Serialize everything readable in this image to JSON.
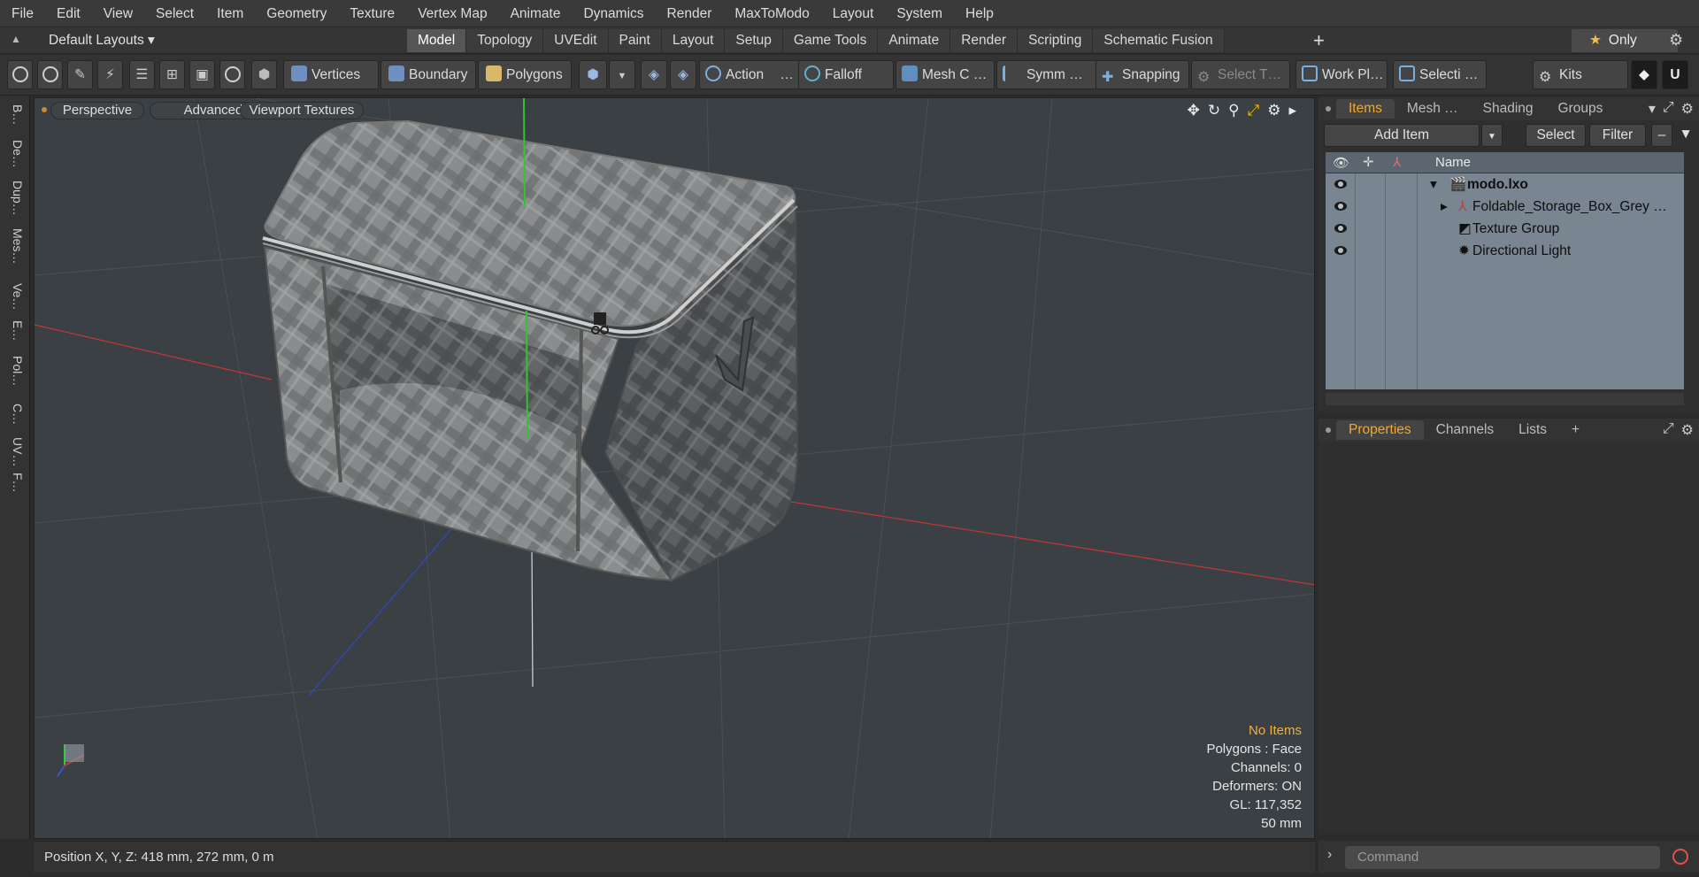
{
  "menu": [
    "File",
    "Edit",
    "View",
    "Select",
    "Item",
    "Geometry",
    "Texture",
    "Vertex Map",
    "Animate",
    "Dynamics",
    "Render",
    "MaxToModo",
    "Layout",
    "System",
    "Help"
  ],
  "layout_bar": {
    "layouts_label": "Default Layouts ▾",
    "tabs": [
      "Model",
      "Topology",
      "UVEdit",
      "Paint",
      "Layout",
      "Setup",
      "Game Tools",
      "Animate",
      "Render",
      "Scripting",
      "Schematic Fusion"
    ],
    "active_tab": "Model",
    "only_label": "Only"
  },
  "toolbar": {
    "vertices": "Vertices",
    "boundary": "Boundary",
    "polygons": "Polygons",
    "action": "Action",
    "action_more": "…",
    "falloff": "Falloff",
    "mesh_c": "Mesh C …",
    "symm": "Symm …",
    "snapping": "Snapping",
    "select_t": "Select T…",
    "work_pl": "Work Pl…",
    "selecti": "Selecti …",
    "kits": "Kits"
  },
  "left_strip": [
    "B…",
    "De…",
    "Dup…",
    "Mes…",
    "Ve…",
    "E…",
    "Pol…",
    "C…",
    "UV…",
    "F…"
  ],
  "viewport": {
    "perspective": "Perspective",
    "advanced": "Advanced",
    "viewport_textures": "Viewport Textures",
    "info": {
      "no_items": "No Items",
      "polygons": "Polygons : Face",
      "channels": "Channels: 0",
      "deformers": "Deformers: ON",
      "gl": "GL: 117,352",
      "scale": "50 mm"
    }
  },
  "status": {
    "position": "Position X, Y, Z:   418 mm, 272 mm, 0 m"
  },
  "items_panel": {
    "tabs": [
      "Items",
      "Mesh …",
      "Shading",
      "Groups"
    ],
    "active_tab": "Items",
    "add_item": "Add Item",
    "select": "Select",
    "filter": "Filter",
    "name_header": "Name",
    "rows": [
      {
        "label": "modo.lxo",
        "bold": true
      },
      {
        "label": "Foldable_Storage_Box_Grey …",
        "bold": false
      },
      {
        "label": "Texture Group",
        "bold": false
      },
      {
        "label": "Directional Light",
        "bold": false
      }
    ]
  },
  "props_panel": {
    "tabs": [
      "Properties",
      "Channels",
      "Lists"
    ],
    "active_tab": "Properties"
  },
  "command": {
    "placeholder": "Command"
  },
  "colors": {
    "accent": "#f0a830",
    "axis_x": "#d83a3a",
    "axis_y": "#2fc02f",
    "axis_z": "#3a55d8"
  }
}
